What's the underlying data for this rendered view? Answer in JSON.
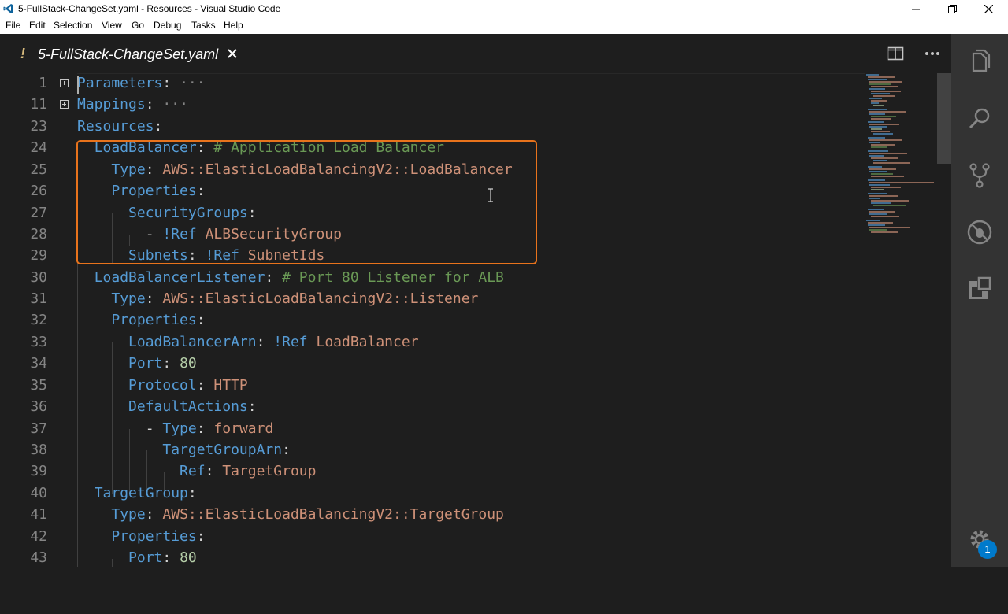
{
  "window": {
    "title": "5-FullStack-ChangeSet.yaml - Resources - Visual Studio Code"
  },
  "menubar": {
    "items": [
      "File",
      "Edit",
      "Selection",
      "View",
      "Go",
      "Debug",
      "Tasks",
      "Help"
    ]
  },
  "tab": {
    "modified_marker": "!",
    "label": "5-FullStack-ChangeSet.yaml"
  },
  "editor": {
    "lines": [
      {
        "num": "1",
        "folded": true
      },
      {
        "num": "11",
        "folded": true
      },
      {
        "num": "23"
      },
      {
        "num": "24"
      },
      {
        "num": "25"
      },
      {
        "num": "26"
      },
      {
        "num": "27"
      },
      {
        "num": "28"
      },
      {
        "num": "29"
      },
      {
        "num": "30"
      },
      {
        "num": "31"
      },
      {
        "num": "32"
      },
      {
        "num": "33"
      },
      {
        "num": "34"
      },
      {
        "num": "35"
      },
      {
        "num": "36"
      },
      {
        "num": "37"
      },
      {
        "num": "38"
      },
      {
        "num": "39"
      },
      {
        "num": "40"
      },
      {
        "num": "41"
      },
      {
        "num": "42"
      },
      {
        "num": "43"
      }
    ],
    "code": {
      "l1_key": "Parameters",
      "l1_ellipsis": "···",
      "l11_key": "Mappings",
      "l11_ellipsis": "···",
      "l23_key": "Resources",
      "l24_key": "LoadBalancer",
      "l24_comment": "# Application Load Balancer",
      "l25_key": "Type",
      "l25_val": "AWS::ElasticLoadBalancingV2::LoadBalancer",
      "l26_key": "Properties",
      "l27_key": "SecurityGroups",
      "l28_dash": "- ",
      "l28_tag": "!Ref",
      "l28_val": "ALBSecurityGroup",
      "l29_key": "Subnets",
      "l29_tag": "!Ref",
      "l29_val": "SubnetIds",
      "l30_key": "LoadBalancerListener",
      "l30_comment": "# Port 80 Listener for ALB",
      "l31_key": "Type",
      "l31_val": "AWS::ElasticLoadBalancingV2::Listener",
      "l32_key": "Properties",
      "l33_key": "LoadBalancerArn",
      "l33_tag": "!Ref",
      "l33_val": "LoadBalancer",
      "l34_key": "Port",
      "l34_val": "80",
      "l35_key": "Protocol",
      "l35_val": "HTTP",
      "l36_key": "DefaultActions",
      "l37_dash": "- ",
      "l37_key": "Type",
      "l37_val": "forward",
      "l38_key": "TargetGroupArn",
      "l39_key": "Ref",
      "l39_val": "TargetGroup",
      "l40_key": "TargetGroup",
      "l41_key": "Type",
      "l41_val": "AWS::ElasticLoadBalancingV2::TargetGroup",
      "l42_key": "Properties",
      "l43_key": "Port",
      "l43_val": "80"
    }
  },
  "activitybar": {
    "icons": [
      "explorer-icon",
      "search-icon",
      "source-control-icon",
      "debug-icon",
      "extensions-icon",
      "manage-gear-icon"
    ],
    "badge": "1"
  },
  "colors": {
    "highlight_box": "#e8731c",
    "key": "#569cd6",
    "string": "#ce9178",
    "comment": "#6a9955",
    "number": "#b5cea8"
  }
}
